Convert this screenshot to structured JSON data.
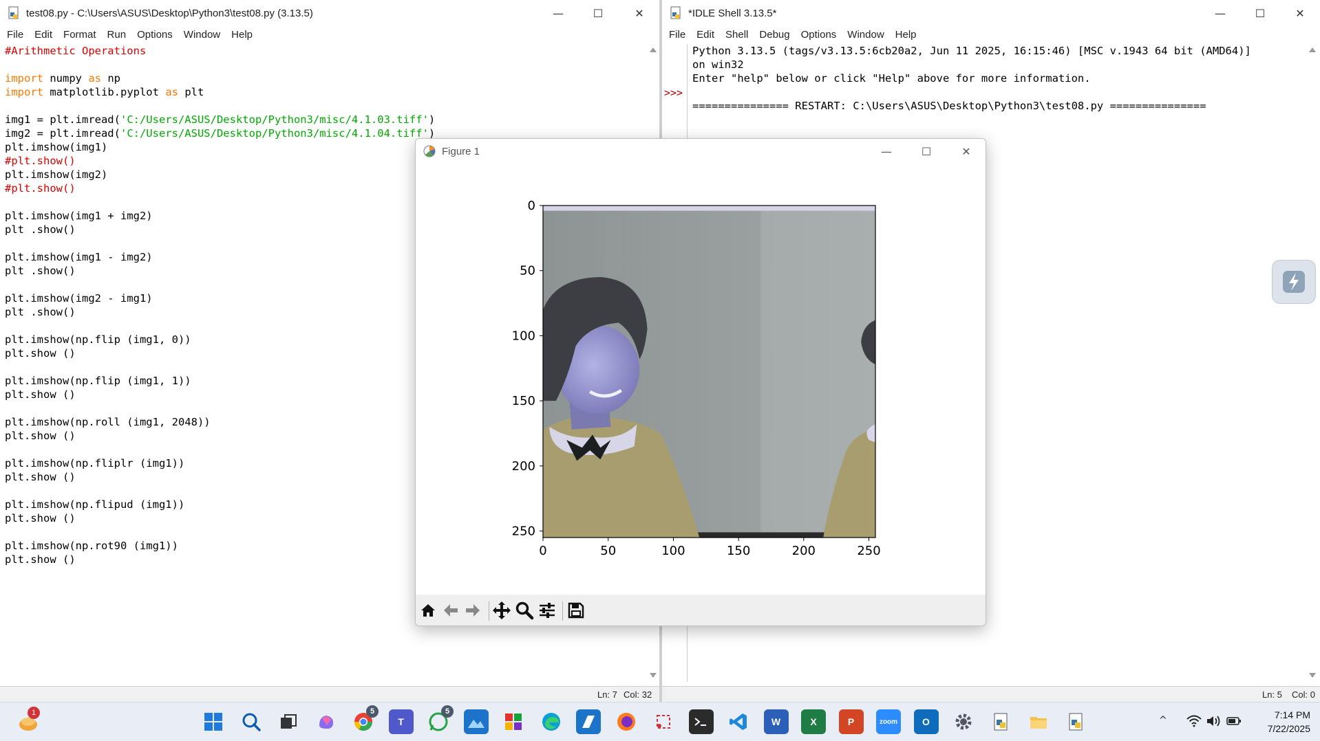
{
  "editor": {
    "title": "test08.py - C:\\Users\\ASUS\\Desktop\\Python3\\test08.py (3.13.5)",
    "menu": [
      "File",
      "Edit",
      "Format",
      "Run",
      "Options",
      "Window",
      "Help"
    ],
    "status": {
      "line": "Ln: 7",
      "col": "Col: 32"
    },
    "code_lines": [
      [
        {
          "t": "#Arithmetic Operations",
          "c": "cm"
        }
      ],
      [],
      [
        {
          "t": "import",
          "c": "kw"
        },
        {
          "t": " numpy "
        },
        {
          "t": "as",
          "c": "kw"
        },
        {
          "t": " np"
        }
      ],
      [
        {
          "t": "import",
          "c": "kw"
        },
        {
          "t": " matplotlib.pyplot "
        },
        {
          "t": "as",
          "c": "kw"
        },
        {
          "t": " plt"
        }
      ],
      [],
      [
        {
          "t": "img1 = plt.imread("
        },
        {
          "t": "'C:/Users/ASUS/Desktop/Python3/misc/4.1.03.tiff'",
          "c": "st"
        },
        {
          "t": ")"
        }
      ],
      [
        {
          "t": "img2 = plt.imread("
        },
        {
          "t": "'C:/Users/ASUS/Desktop/Python3/misc/4.1.04.tiff'",
          "c": "st"
        },
        {
          "t": ")"
        }
      ],
      [
        {
          "t": "plt.imshow(img1)"
        }
      ],
      [
        {
          "t": "#plt.show()",
          "c": "cm"
        }
      ],
      [
        {
          "t": "plt.imshow(img2)"
        }
      ],
      [
        {
          "t": "#plt.show()",
          "c": "cm"
        }
      ],
      [],
      [
        {
          "t": "plt.imshow(img1 + img2)"
        }
      ],
      [
        {
          "t": "plt .show()"
        }
      ],
      [],
      [
        {
          "t": "plt.imshow(img1 - img2)"
        }
      ],
      [
        {
          "t": "plt .show()"
        }
      ],
      [],
      [
        {
          "t": "plt.imshow(img2 - img1)"
        }
      ],
      [
        {
          "t": "plt .show()"
        }
      ],
      [],
      [
        {
          "t": "plt.imshow(np.flip (img1, 0))"
        }
      ],
      [
        {
          "t": "plt.show ()"
        }
      ],
      [],
      [
        {
          "t": "plt.imshow(np.flip (img1, 1))"
        }
      ],
      [
        {
          "t": "plt.show ()"
        }
      ],
      [],
      [
        {
          "t": "plt.imshow(np.roll (img1, 2048))"
        }
      ],
      [
        {
          "t": "plt.show ()"
        }
      ],
      [],
      [
        {
          "t": "plt.imshow(np.fliplr (img1))"
        }
      ],
      [
        {
          "t": "plt.show ()"
        }
      ],
      [],
      [
        {
          "t": "plt.imshow(np.flipud (img1))"
        }
      ],
      [
        {
          "t": "plt.show ()"
        }
      ],
      [],
      [
        {
          "t": "plt.imshow(np.rot90 (img1))"
        }
      ],
      [
        {
          "t": "plt.show ()"
        }
      ]
    ]
  },
  "shell": {
    "title": "*IDLE Shell 3.13.5*",
    "menu": [
      "File",
      "Edit",
      "Shell",
      "Debug",
      "Options",
      "Window",
      "Help"
    ],
    "prompt": ">>>",
    "lines": [
      "Python 3.13.5 (tags/v3.13.5:6cb20a2, Jun 11 2025, 16:15:46) [MSC v.1943 64 bit (AMD64)]",
      "on win32",
      "Enter \"help\" below or click \"Help\" above for more information.",
      "",
      "=============== RESTART: C:\\Users\\ASUS\\Desktop\\Python3\\test08.py ==============="
    ],
    "status": {
      "line": "Ln: 5",
      "col": "Col: 0"
    }
  },
  "figure": {
    "title": "Figure 1",
    "toolbar": [
      "home-icon",
      "back-icon",
      "forward-icon",
      "pan-icon",
      "zoom-icon",
      "configure-icon",
      "save-icon"
    ]
  },
  "chart_data": {
    "type": "image",
    "xlim": [
      0,
      255
    ],
    "ylim": [
      255,
      0
    ],
    "xticks": [
      0,
      50,
      100,
      150,
      200,
      250
    ],
    "yticks": [
      0,
      50,
      100,
      150,
      200,
      250
    ],
    "xtick_labels": [
      "0",
      "50",
      "100",
      "150",
      "200",
      "250"
    ],
    "ytick_labels": [
      "0",
      "50",
      "100",
      "150",
      "200",
      "250"
    ]
  },
  "taskbar": {
    "clock_time": "7:14 PM",
    "clock_date": "7/22/2025",
    "notification_count": "1",
    "badges": {
      "chrome": "5",
      "whatsapp": "5"
    },
    "apps": [
      "start",
      "search",
      "task-view",
      "copilot",
      "chrome",
      "teams",
      "whatsapp",
      "photos",
      "office",
      "edge",
      "vscode-insiders",
      "firefox",
      "snipping-tool",
      "terminal",
      "vscode",
      "word",
      "excel",
      "powerpoint",
      "zoom",
      "outlook",
      "settings",
      "python-idle",
      "file-explorer",
      "python-idle-2"
    ],
    "colors": {
      "accent": "#0067c0",
      "background": "#e9eef6"
    }
  }
}
